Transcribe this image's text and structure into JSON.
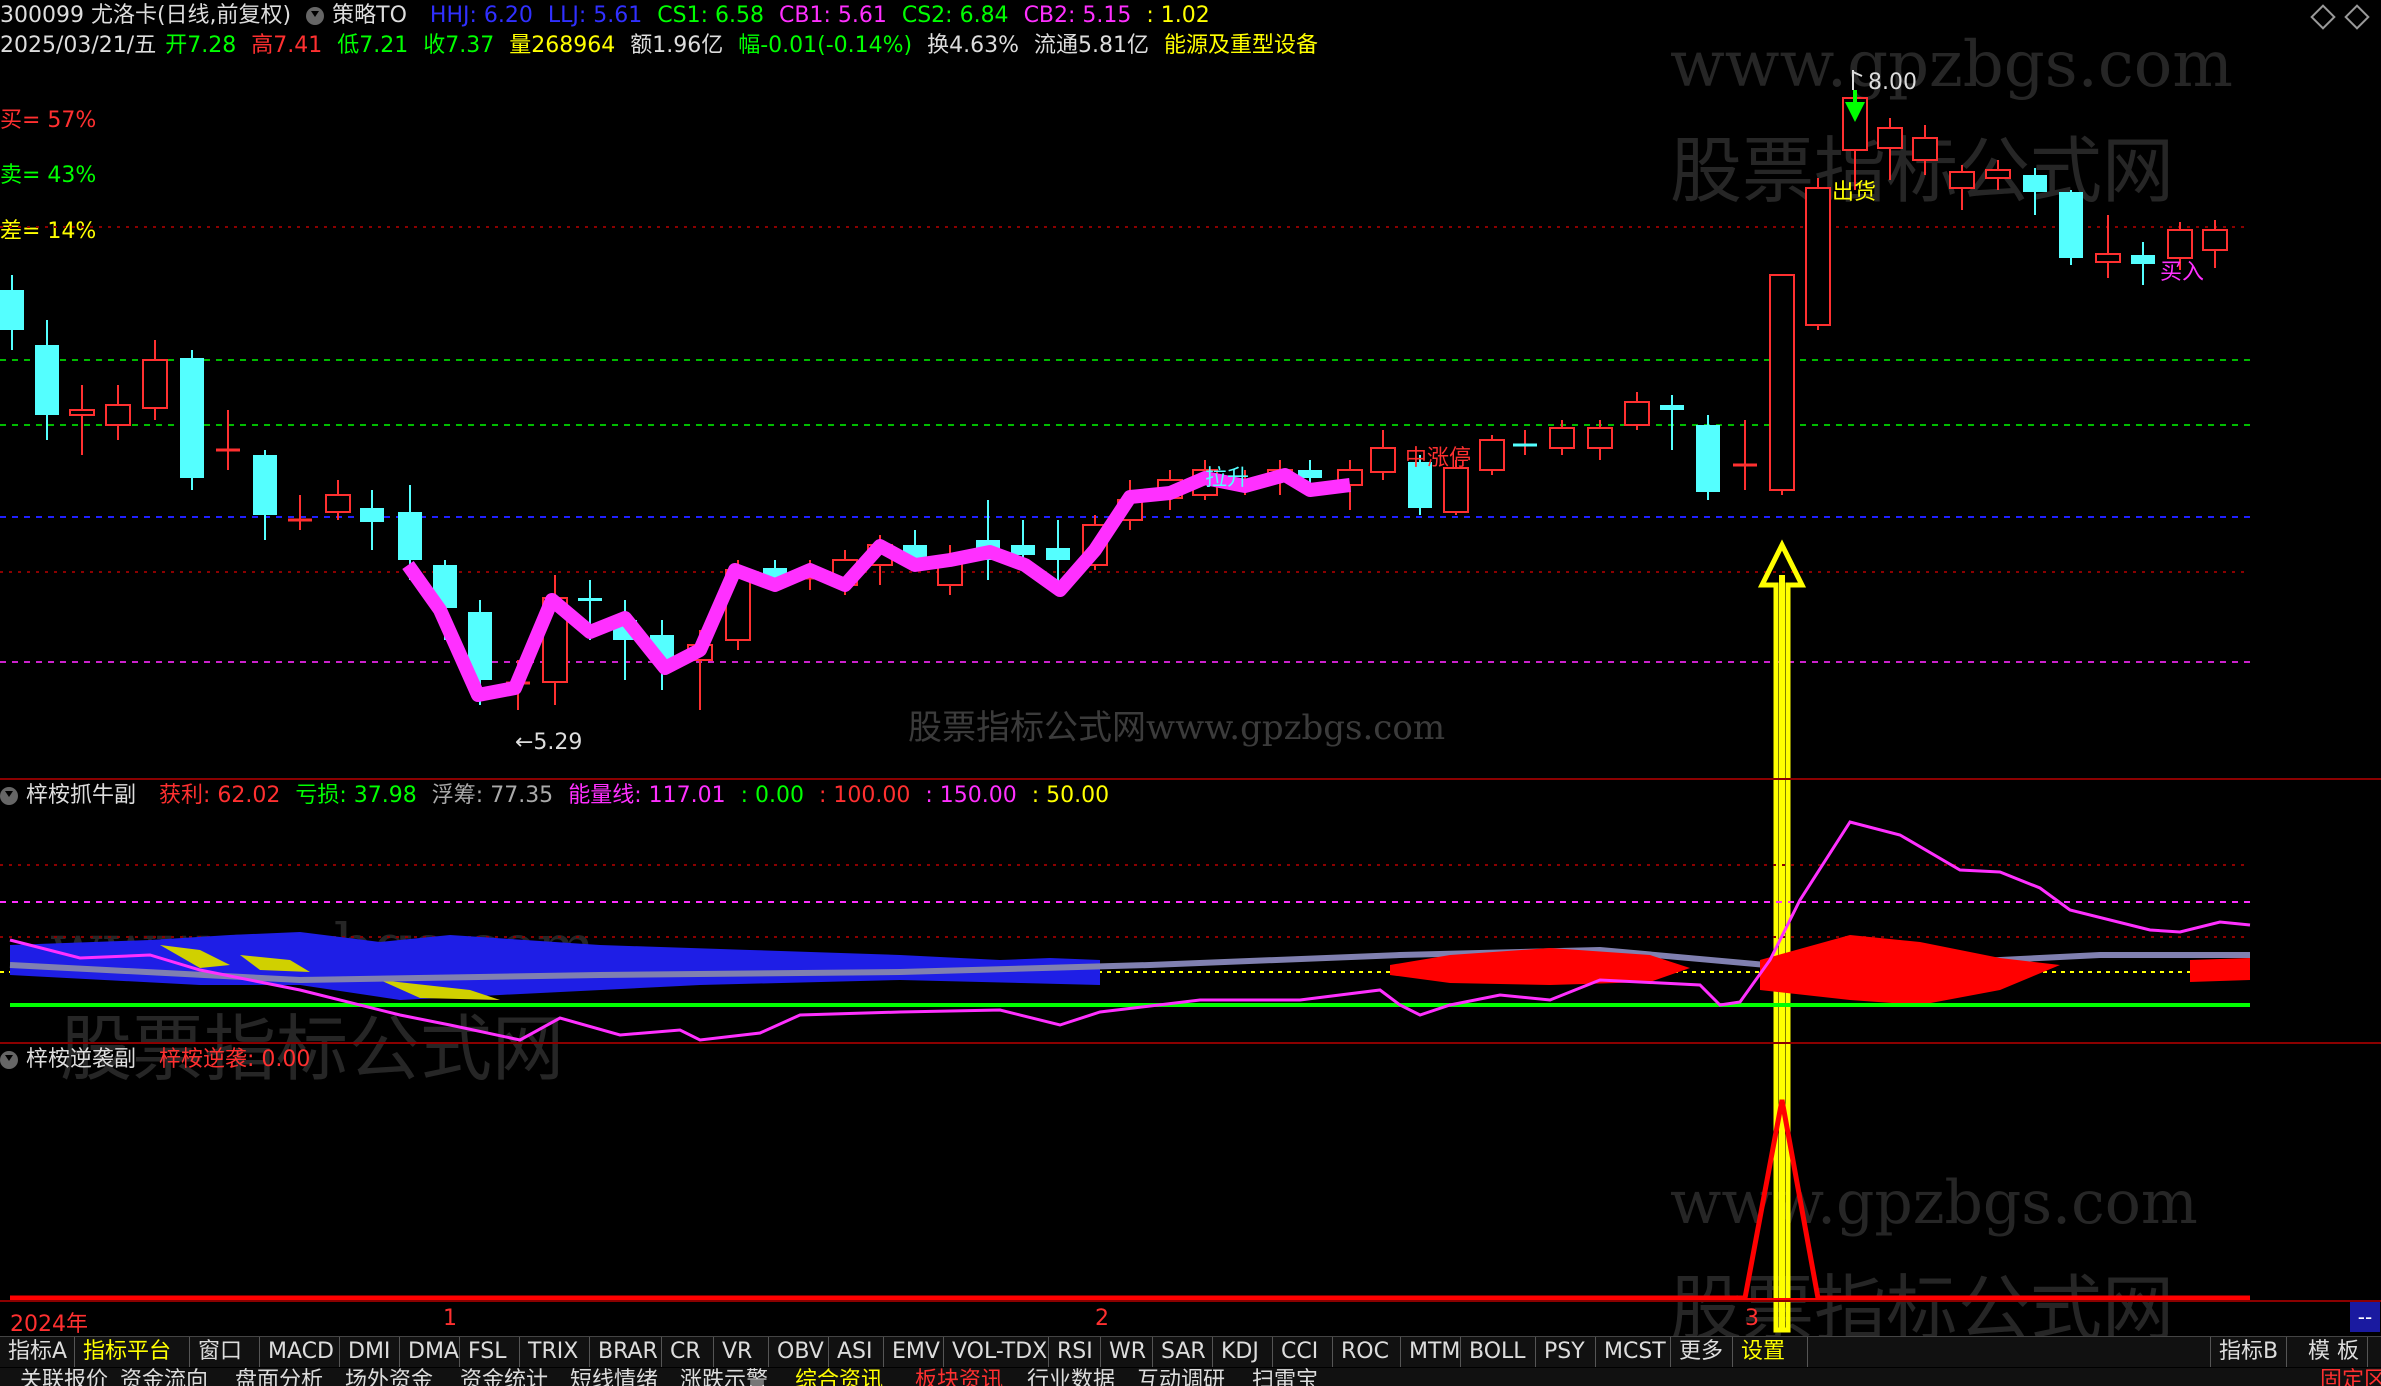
{
  "header": {
    "code_name": "300099 尤洛卡(日线,前复权)",
    "strategy": "策略TO",
    "hhj": "HHJ: 6.20",
    "llj": "LLJ: 5.61",
    "cs1": "CS1: 6.58",
    "cb1": "CB1: 5.61",
    "cs2": "CS2: 6.84",
    "cb2": "CB2: 5.15",
    "extra": ": 1.02",
    "date": "2025/03/21/五",
    "open": "开7.28",
    "high": "高7.41",
    "low": "低7.21",
    "close": "收7.37",
    "volume": "量268964",
    "amount": "额1.96亿",
    "change": "幅-0.01(-0.14%)",
    "turnover": "换4.63%",
    "float": "流通5.81亿",
    "sector": "能源及重型设备"
  },
  "stats": {
    "buy": "买= 57%",
    "sell": "卖= 43%",
    "diff": "差= 14%"
  },
  "main_chart": {
    "high_label": "8.00",
    "low_label": "←5.29",
    "label_chuhuo": "出货",
    "label_mairu": "买入",
    "label_lasheng": "拉升",
    "label_zhangting": "中涨停",
    "watermark_center": "股票指标公式网www.gpzbgs.com"
  },
  "sub1": {
    "title": "梓桉抓牛副",
    "profit": "获利: 62.02",
    "loss": "亏损: 37.98",
    "float_chip": "浮筹: 77.35",
    "energy": "能量线: 117.01",
    "v0": ": 0.00",
    "v100": ": 100.00",
    "v150": ": 150.00",
    "v50": ": 50.00"
  },
  "sub2": {
    "title": "梓桉逆袭副",
    "value": "梓桉逆袭: 0.00"
  },
  "watermarks": {
    "url": "www.gpzbgs.com",
    "cn": "股票指标公式网"
  },
  "time_axis": {
    "year": "2024年",
    "m1": "1",
    "m2": "2",
    "m3": "3",
    "right": "--"
  },
  "tabs": [
    "指标A",
    "指标平台",
    "窗口",
    "MACD",
    "DMI",
    "DMA",
    "FSL",
    "TRIX",
    "BRAR",
    "CR",
    "VR",
    "OBV",
    "ASI",
    "EMV",
    "VOL-TDX",
    "RSI",
    "WR",
    "SAR",
    "KDJ",
    "CCI",
    "ROC",
    "MTM",
    "BOLL",
    "PSY",
    "MCST",
    "更多",
    "设置"
  ],
  "tabs_right": [
    "指标B",
    "模 板"
  ],
  "bottom_tabs": [
    "关联报价",
    "资金流向",
    "盘面分析",
    "场外资金",
    "资金统计",
    "短线情绪",
    "涨跌示警",
    "综合资讯",
    "板块资讯",
    "行业数据",
    "互动调研",
    "扫雷宝"
  ],
  "bottom_right": "固定区",
  "colors": {
    "up": "#ff3030",
    "down": "#54ffff",
    "magenta": "#ff30ff",
    "yellow": "#ffff00",
    "green": "#00ff00",
    "blue": "#1e1ee6"
  }
}
